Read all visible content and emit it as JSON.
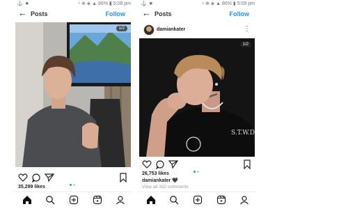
{
  "screens": [
    {
      "status_left": "⚓ ■",
      "status_right": "◔ ⊗ ◈ ▲ 86% ▮ 5:08 pm",
      "header_title": "Posts",
      "follow_label": "Follow",
      "image_counter": "1/2",
      "likes": "35,299 likes",
      "caption_fragment": "… … …  … …"
    },
    {
      "status_left": "⚓ ■",
      "status_right": "◔ ⊗ ◈ ▲ 86% ▮ 5:09 pm",
      "header_title": "Posts",
      "follow_label": "Follow",
      "username": "damiankater",
      "image_counter": "1/2",
      "likes": "26,753 likes",
      "caption_user": "damiankater",
      "caption_text": "🖤",
      "comments": "View all 302 comments"
    }
  ],
  "icons": {
    "back": "arrow-left",
    "more": "three-dots",
    "like": "heart-outline",
    "comment": "speech-bubble",
    "share": "paper-plane",
    "save": "bookmark",
    "nav": [
      "home",
      "search",
      "new-post",
      "reels",
      "profile"
    ]
  },
  "colors": {
    "accent": "#2d8ef0",
    "text": "#222222",
    "muted": "#999999"
  }
}
